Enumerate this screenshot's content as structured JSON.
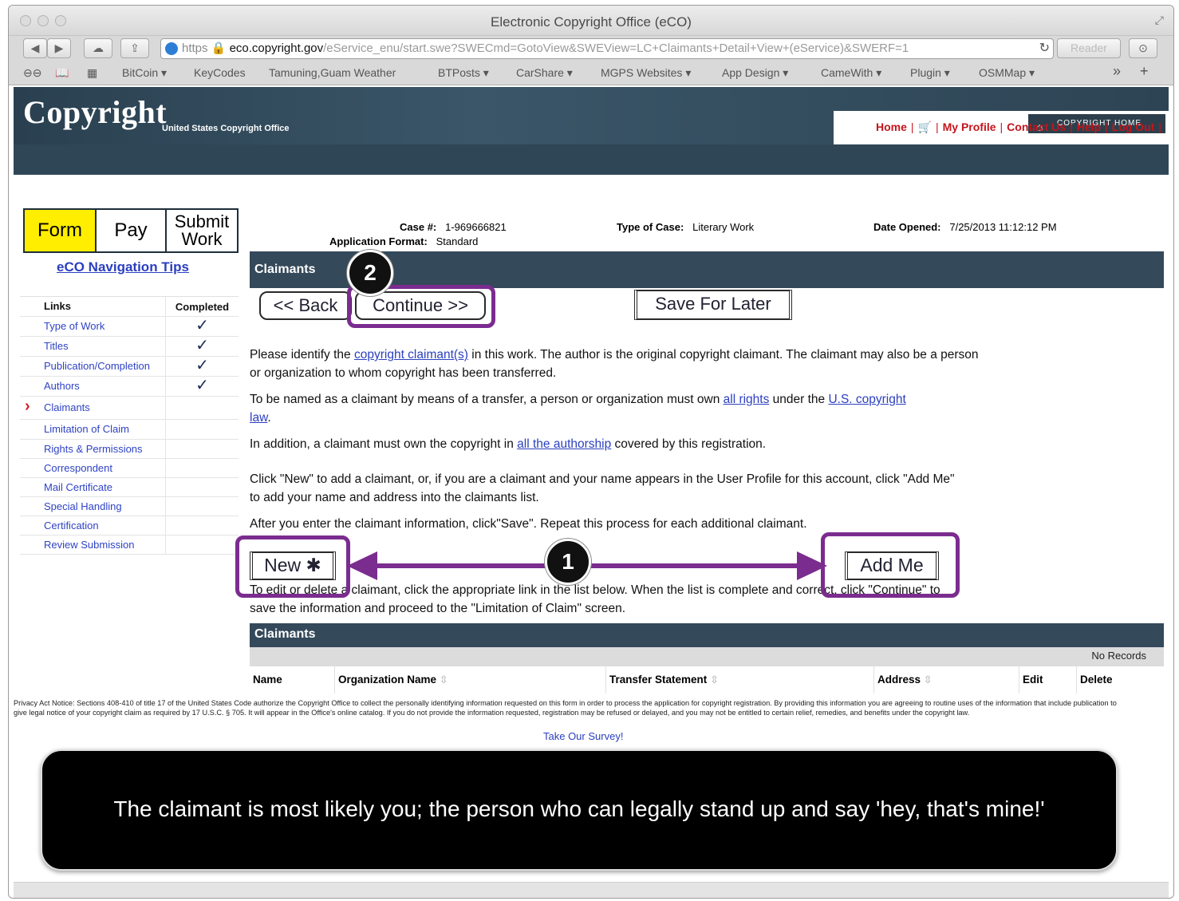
{
  "window": {
    "title": "Electronic Copyright Office (eCO)"
  },
  "toolbar": {
    "url_scheme": "https",
    "url_host": "eco.copyright.gov",
    "url_path": "/eService_enu/start.swe?SWECmd=GotoView&SWEView=LC+Claimants+Detail+View+(eService)&SWERF=1",
    "reader_label": "Reader"
  },
  "bookmarks": [
    "BitCoin ▾",
    "KeyCodes",
    "Tamuning,Guam Weather",
    "BTPosts ▾",
    "CarShare ▾",
    "MGPS Websites ▾",
    "App Design ▾",
    "CameWith ▾",
    "Plugin ▾",
    "OSMMap ▾"
  ],
  "header": {
    "logo": "Copyright",
    "logo_sub": "United States Copyright Office",
    "copyright_home": "COPYRIGHT HOME",
    "nav": {
      "home": "Home",
      "my_profile": "My Profile",
      "contact_us": "Contact Us",
      "help": "Help",
      "log_out": "Log Out"
    }
  },
  "steps": {
    "form": "Form",
    "pay": "Pay",
    "submit_work": "Submit Work"
  },
  "nav_tips": "eCO Navigation Tips",
  "links_table": {
    "header_links": "Links",
    "header_completed": "Completed",
    "items": [
      {
        "label": "Type of Work",
        "completed": "✓"
      },
      {
        "label": "Titles",
        "completed": "✓"
      },
      {
        "label": "Publication/Completion",
        "completed": "✓"
      },
      {
        "label": "Authors",
        "completed": "✓"
      },
      {
        "label": "Claimants",
        "completed": ""
      },
      {
        "label": "Limitation of Claim",
        "completed": ""
      },
      {
        "label": "Rights & Permissions",
        "completed": ""
      },
      {
        "label": "Correspondent",
        "completed": ""
      },
      {
        "label": "Mail Certificate",
        "completed": ""
      },
      {
        "label": "Special Handling",
        "completed": ""
      },
      {
        "label": "Certification",
        "completed": ""
      },
      {
        "label": "Review Submission",
        "completed": ""
      }
    ]
  },
  "case": {
    "case_label": "Case #:",
    "case_value": "1-969666821",
    "format_label": "Application Format:",
    "format_value": "Standard",
    "type_label": "Type of Case:",
    "type_value": "Literary Work",
    "date_label": "Date Opened:",
    "date_value": "7/25/2013 11:12:12 PM"
  },
  "section_title": "Claimants",
  "buttons": {
    "back": "<< Back",
    "continue": "Continue >>",
    "save_for_later": "Save For Later",
    "new": "New ✱",
    "add_me": "Add Me"
  },
  "callouts": {
    "one": "1",
    "two": "2"
  },
  "paragraphs": {
    "p1_a": "Please identify the ",
    "p1_link": "copyright claimant(s)",
    "p1_b": " in this work. The author is the original copyright claimant. The claimant may also be a person or organization to whom copyright has been transferred.",
    "p2_a": "To be named as a claimant by means of a transfer, a person or organization must own ",
    "p2_link1": "all rights",
    "p2_b": " under the ",
    "p2_link2": "U.S. copyright law",
    "p2_c": ".",
    "p3_a": "In addition, a claimant must own the copyright in ",
    "p3_link": "all the authorship",
    "p3_b": " covered by this registration.",
    "p4": "Click \"New\" to add a claimant, or, if you are a claimant and your name appears in the User Profile for this account, click \"Add Me\" to add your name and address into the claimants list.",
    "p5": "After you enter the claimant information, click\"Save\". Repeat this process for each additional claimant.",
    "p6": "To edit or delete a claimant, click the appropriate link in the list below. When the list is complete and correct, click \"Continue\" to save the information and proceed to the \"Limitation of Claim\" screen."
  },
  "claimants_table": {
    "title": "Claimants",
    "no_records": "No Records",
    "columns": [
      "Name",
      "Organization Name",
      "Transfer Statement",
      "Address",
      "Edit",
      "Delete"
    ]
  },
  "footer": {
    "privacy": "Privacy Act Notice: Sections 408-410 of title 17 of the United States Code authorize the Copyright Office to collect the personally identifying information requested on this form in order to process the application for copyright registration. By providing this information you are agreeing to routine uses of the information that include publication to give legal notice of your copyright claim as required by 17 U.S.C. § 705. It will appear in the Office's online catalog. If you do not provide the information requested, registration may be refused or delayed, and you may not be entitled to certain relief, remedies, and benefits under the copyright law.",
    "survey": "Take Our Survey!"
  },
  "caption": "The claimant is most likely you; the person who can legally stand up and say 'hey, that's mine!'",
  "colors": {
    "highlight": "#7b2c8f",
    "header": "#34495a",
    "step_active": "#ffee00",
    "nav_link": "#c4151c",
    "link": "#2b3fbf"
  }
}
